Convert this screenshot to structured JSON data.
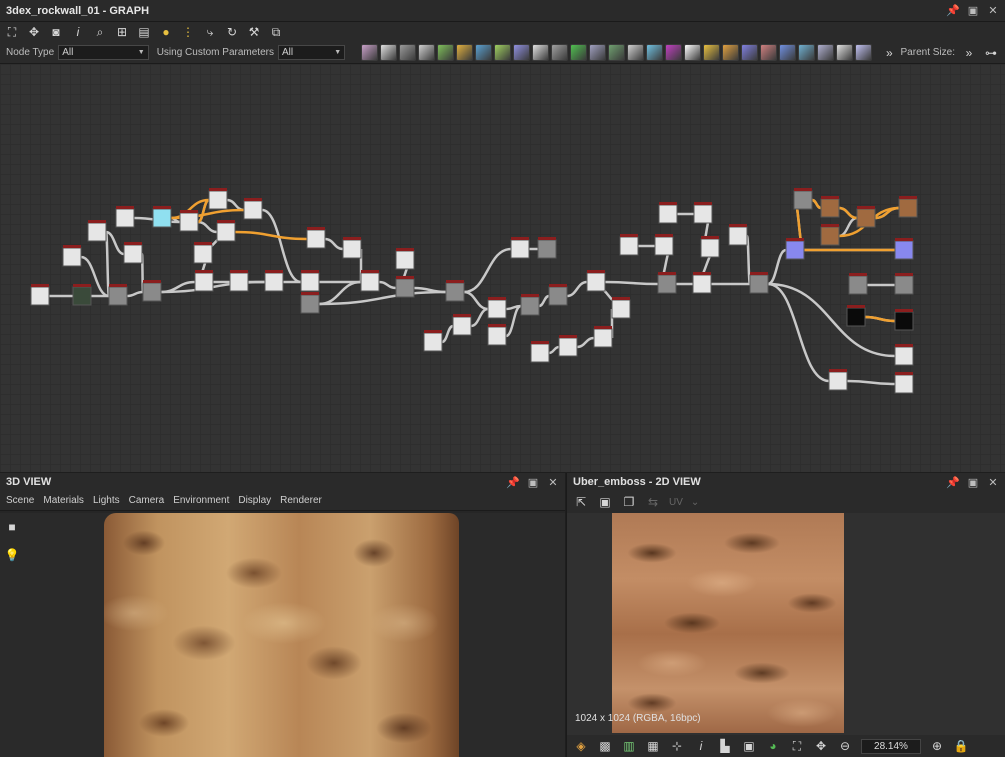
{
  "graph": {
    "title": "3dex_rockwall_01 - GRAPH",
    "node_type_label": "Node Type",
    "node_type_value": "All",
    "params_label": "Using Custom Parameters",
    "params_value": "All",
    "parent_size_label": "Parent Size:",
    "atom_colors": [
      "#c8a0c8",
      "#e0e0e0",
      "#9a9a9a",
      "#cfcfcf",
      "#7fbf5a",
      "#e0b040",
      "#5aa0d0",
      "#a0d060",
      "#9090e0",
      "#e0e0e0",
      "#a0a0a0",
      "#50c050",
      "#a0a0c0",
      "#70a070",
      "#d0d0d0",
      "#70c0e0",
      "#c040c0",
      "#ffffff",
      "#e8c040",
      "#e0a040",
      "#8080e0",
      "#d08080",
      "#7090e0",
      "#70b0d0",
      "#b0b0d0",
      "#e0e0e0",
      "#c0c0f0"
    ]
  },
  "view3d": {
    "title": "3D VIEW",
    "menu": [
      "Scene",
      "Materials",
      "Lights",
      "Camera",
      "Environment",
      "Display",
      "Renderer"
    ]
  },
  "view2d": {
    "title": "Uber_emboss - 2D VIEW",
    "uv_label": "UV",
    "resolution": "1024 x 1024 (RGBA, 16bpc)",
    "zoom": "28.14%"
  }
}
